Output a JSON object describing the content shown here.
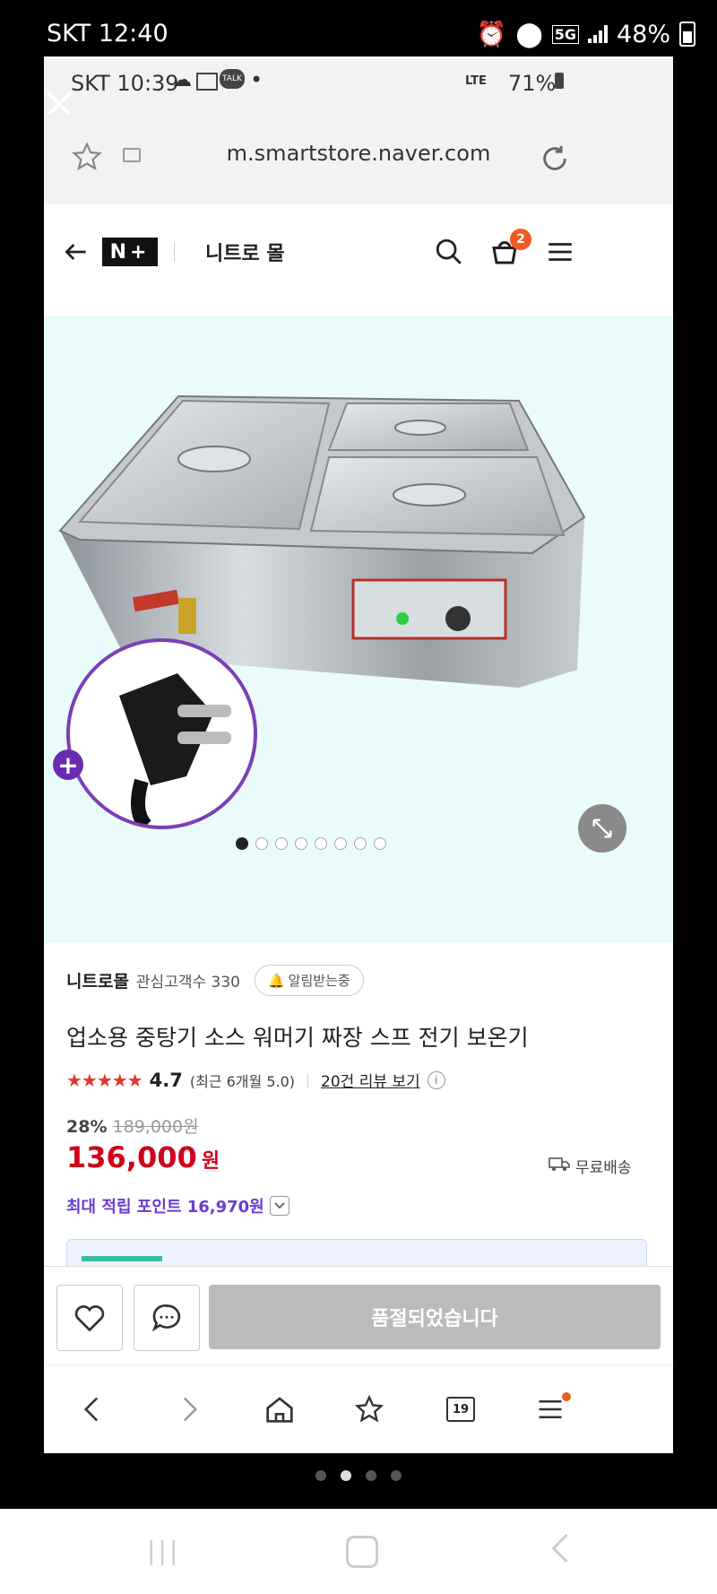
{
  "outer_status": {
    "time": "SKT 12:40",
    "network": "5G",
    "battery": "48%"
  },
  "inner_status": {
    "time": "SKT 10:39",
    "network": "LTE",
    "battery": "71%",
    "chat_badge": "TALK"
  },
  "browser": {
    "url": "m.smartstore.naver.com"
  },
  "site_header": {
    "brand_logo": "N+",
    "store_name": "니트로 몰",
    "cart_count": "2"
  },
  "hero": {
    "image_count": 8,
    "active_index": 0
  },
  "product": {
    "seller": "니트로몰",
    "followers_label": "관심고객수 330",
    "notify_label": "알림받는중",
    "title": "업소용 중탕기 소스 워머기 짜장 스프 전기 보온기",
    "rating": "4.7",
    "recent_rating": "(최근 6개월 5.0)",
    "review_link": "20건 리뷰 보기",
    "discount": "28%",
    "original_price": "189,000원",
    "sale_price": "136,000",
    "currency": "원",
    "shipping": "무료배송",
    "points": "최대 적립 포인트 16,970원"
  },
  "buy_bar": {
    "soldout_label": "품절되었습니다"
  },
  "browser_nav": {
    "tabs_count": "19"
  },
  "colors": {
    "price_red": "#d0021b",
    "points_purple": "#6a3cd4",
    "hero_bg": "#e9fbfb",
    "plus_purple": "#6b2bb0"
  }
}
